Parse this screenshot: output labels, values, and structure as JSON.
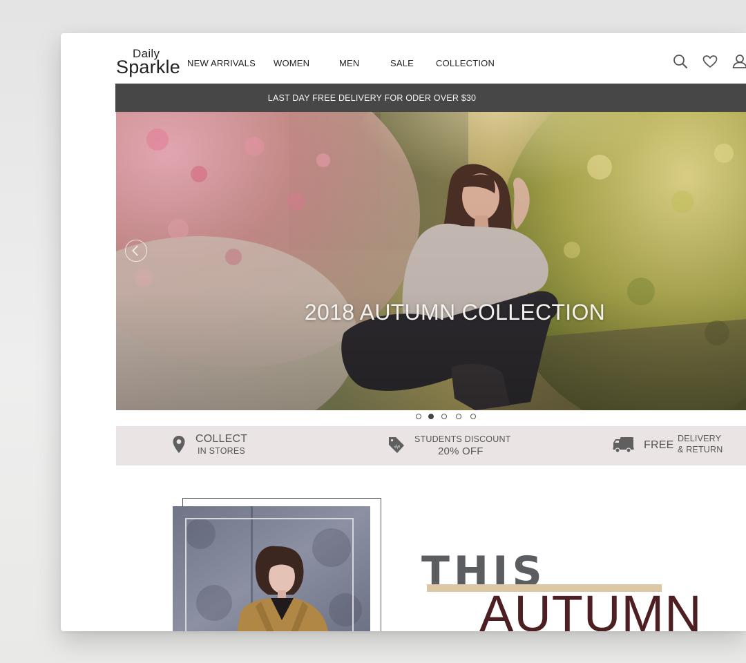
{
  "header": {
    "logo_top": "Daily",
    "logo_bottom": "Sparkle",
    "nav": [
      "NEW ARRIVALS",
      "WOMEN",
      "MEN",
      "SALE",
      "COLLECTION"
    ],
    "icons": [
      "search-icon",
      "heart-icon",
      "user-icon"
    ]
  },
  "promo": {
    "text": "LAST DAY FREE DELIVERY FOR ODER OVER $30"
  },
  "hero": {
    "title": "2018 AUTUMN COLLECTION",
    "slide_count": 5,
    "active_slide": 2
  },
  "features": {
    "collect": {
      "line1": "COLLECT",
      "line2": "IN STORES",
      "icon": "location-pin-icon"
    },
    "students": {
      "line1": "STUDENTS DISCOUNT",
      "line2": "20% OFF",
      "icon": "discount-tag-icon"
    },
    "delivery": {
      "label": "FREE",
      "line1": "DELIVERY",
      "line2": "& RETURN",
      "icon": "truck-icon"
    }
  },
  "feature_section": {
    "word1": "THIS",
    "word2": "AUTUMN"
  },
  "colors": {
    "promo_bg": "#474747",
    "features_bg": "#ebe4e5",
    "autumn_text": "#4d1f22",
    "this_text": "#5b5d60",
    "accent_bar": "#dcc8a4"
  }
}
